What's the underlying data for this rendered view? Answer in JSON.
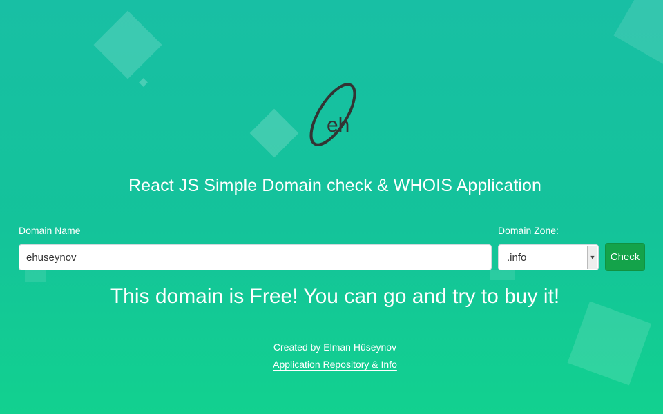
{
  "logo": {
    "text": "eh"
  },
  "app_title": "React JS Simple Domain check & WHOIS Application",
  "form": {
    "domain_label": "Domain Name",
    "domain_value": "ehuseynov",
    "zone_label": "Domain Zone:",
    "zone_value": ".info",
    "check_label": "Check"
  },
  "result_message": "This domain is Free! You can go and try to buy it!",
  "footer": {
    "created_by": "Created by",
    "author_link": "Elman Hüseynov",
    "repo_link": "Application Repository & Info"
  },
  "colors": {
    "background_top": "#18bfa4",
    "background_bottom": "#12d18f",
    "check_button": "#14a34a"
  }
}
